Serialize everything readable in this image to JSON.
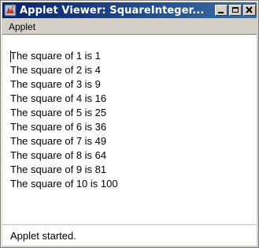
{
  "window": {
    "title": "Applet Viewer: SquareInteger...",
    "icon": "java-applet-icon",
    "buttons": [
      "minimize",
      "maximize",
      "close"
    ]
  },
  "menubar": {
    "items": [
      "Applet"
    ]
  },
  "content": {
    "lines": [
      "The square of 1 is 1",
      "The square of 2 is 4",
      "The square of 3 is 9",
      "The square of 4 is 16",
      "The square of 5 is 25",
      "The square of 6 is 36",
      "The square of 7 is 49",
      "The square of 8 is 64",
      "The square of 9 is 81",
      "The square of 10 is 100"
    ]
  },
  "status": {
    "text": "Applet started."
  }
}
